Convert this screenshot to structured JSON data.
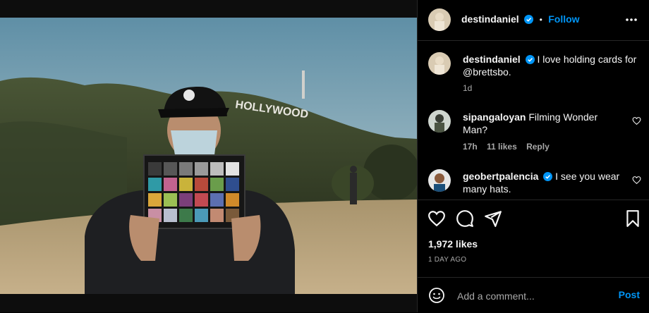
{
  "colors": {
    "accent": "#0095f6",
    "background": "#000000",
    "muted": "#a8a8a8",
    "verified": "#0095f6"
  },
  "post": {
    "author": "destindaniel",
    "follow_label": "Follow",
    "dot": "•",
    "more_icon": "more-horizontal-icon",
    "caption_text": "I love holding cards for @brettsbo.",
    "caption_age": "1d"
  },
  "comments": [
    {
      "user": "sipangaloyan",
      "text": "Filming Wonder Man?",
      "age": "17h",
      "likes": "11 likes",
      "reply": "Reply"
    },
    {
      "user": "geobertpalencia",
      "verified": true,
      "text": "I see you wear many hats."
    }
  ],
  "actions": {
    "likes_count": "1,972 likes",
    "date": "1 DAY AGO"
  },
  "composer": {
    "placeholder": "Add a comment...",
    "post_label": "Post"
  },
  "photo": {
    "sign_text": "HOLLYWOOD"
  }
}
